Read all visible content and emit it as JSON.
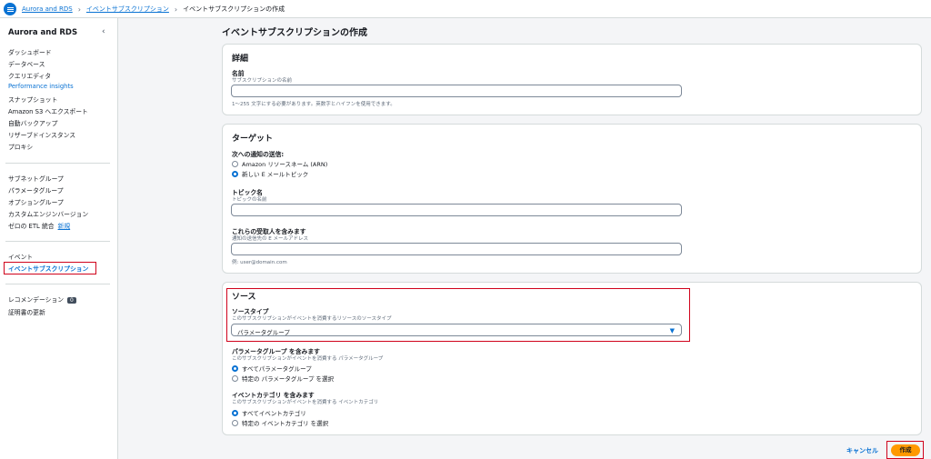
{
  "breadcrumb": {
    "root": "Aurora and RDS",
    "parent": "イベントサブスクリプション",
    "current": "イベントサブスクリプションの作成"
  },
  "sidebar": {
    "title": "Aurora and RDS",
    "group1": [
      "ダッシュボード",
      "データベース",
      "クエリエディタ",
      "Performance insights",
      "スナップショット",
      "Amazon S3 へエクスポート",
      "自動バックアップ",
      "リザーブドインスタンス",
      "プロキシ"
    ],
    "group2": [
      "サブネットグループ",
      "パラメータグループ",
      "オプショングループ",
      "カスタムエンジンバージョン",
      "ゼロの ETL 統合"
    ],
    "new_label": "新規",
    "group3": [
      "イベント",
      "イベントサブスクリプション"
    ],
    "group4": [
      "レコメンデーション",
      "証明書の更新"
    ],
    "recommendation_count": "0"
  },
  "page": {
    "title": "イベントサブスクリプションの作成"
  },
  "details": {
    "heading": "詳細",
    "name_label": "名前",
    "name_desc": "サブスクリプションの名前",
    "name_hint": "1〜255 文字にする必要があります。英数字とハイフンを使用できます。"
  },
  "target": {
    "heading": "ターゲット",
    "send_label": "次への通知の送信:",
    "option_arn": "Amazon リソースネーム (ARN)",
    "option_new_topic": "新しい E メールトピック",
    "topic_label": "トピック名",
    "topic_desc": "トピックの名前",
    "recipients_label": "これらの受取人を含みます",
    "recipients_desc": "通知の送信先の E メールアドレス",
    "recipients_hint": "例: user@domain.com"
  },
  "source": {
    "heading": "ソース",
    "type_label": "ソースタイプ",
    "type_desc": "このサブスクリプションがイベントを消費するリソースのソースタイプ",
    "type_value": "パラメータグループ",
    "include_pg_label": "パラメータグループ を含みます",
    "include_pg_desc": "このサブスクリプションがイベントを消費する パラメータグループ",
    "pg_all": "すべてパラメータグループ",
    "pg_specific": "特定の パラメータグループ を選択",
    "include_cat_label": "イベントカテゴリ を含みます",
    "include_cat_desc": "このサブスクリプションがイベントを消費する イベントカテゴリ",
    "cat_all": "すべてイベントカテゴリ",
    "cat_specific": "特定の イベントカテゴリ を選択"
  },
  "actions": {
    "cancel": "キャンセル",
    "create": "作成"
  }
}
